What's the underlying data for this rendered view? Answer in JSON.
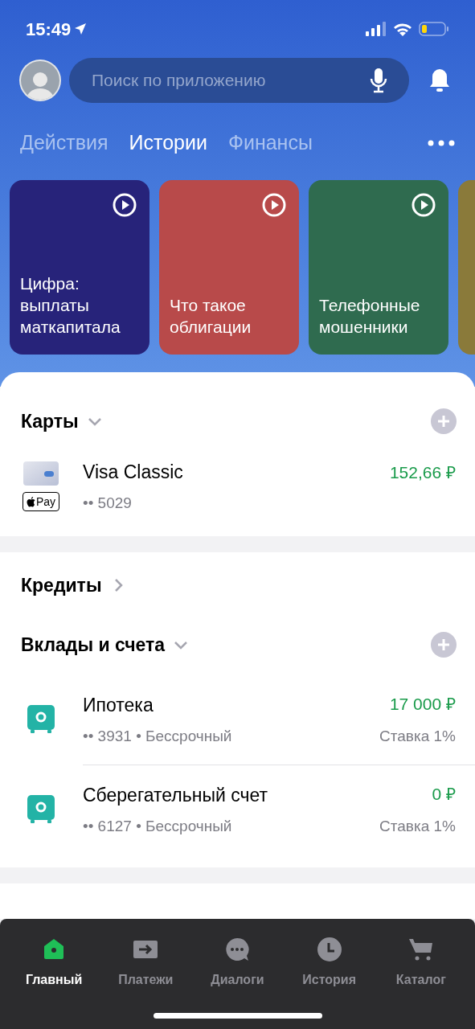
{
  "status_bar": {
    "time": "15:49"
  },
  "search": {
    "placeholder": "Поиск по приложению"
  },
  "tabs": [
    {
      "label": "Действия",
      "selected": false
    },
    {
      "label": "Истории",
      "selected": true
    },
    {
      "label": "Финансы",
      "selected": false
    }
  ],
  "stories": [
    {
      "title": "Цифра:\nвыплаты\nматкапитала",
      "color": "#27237a"
    },
    {
      "title": "Что такое\nоблигации",
      "color": "#b84a4a"
    },
    {
      "title": "Телефонные\nмошенники",
      "color": "#2f6b4f"
    },
    {
      "color": "#8a7a3a"
    }
  ],
  "groups": [
    {
      "title": "Карты",
      "expanded": true,
      "addable": true,
      "items": [
        {
          "kind": "card",
          "name": "Visa Classic",
          "detail": "•• 5029",
          "amount": "152,66 ₽",
          "pay_label": "Pay"
        }
      ]
    },
    {
      "title": "Кредиты",
      "expanded": false,
      "addable": false
    },
    {
      "title": "Вклады и счета",
      "expanded": true,
      "addable": true,
      "items": [
        {
          "kind": "safe",
          "name": "Ипотека",
          "detail": "•• 3931 • Бессрочный",
          "amount": "17 000 ₽",
          "rate": "Ставка 1%"
        },
        {
          "kind": "safe",
          "name": "Сберегательный счет",
          "detail": "•• 6127 • Бессрочный",
          "amount": "0 ₽",
          "rate": "Ставка 1%"
        }
      ]
    }
  ],
  "tab_bar": [
    {
      "label": "Главный",
      "kind": "home",
      "selected": true
    },
    {
      "label": "Платежи",
      "kind": "payments",
      "selected": false
    },
    {
      "label": "Диалоги",
      "kind": "chat",
      "selected": false
    },
    {
      "label": "История",
      "kind": "history",
      "selected": false
    },
    {
      "label": "Каталог",
      "kind": "cart",
      "selected": false
    }
  ]
}
